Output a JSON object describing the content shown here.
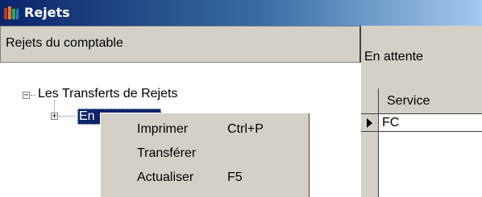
{
  "window": {
    "title": "Rejets",
    "icon": "books-icon"
  },
  "left_panel": {
    "header": "Rejets du comptable",
    "tree": {
      "root_label": "Les Transferts de Rejets",
      "root_expander": "−",
      "child_label": "En",
      "child_expander": "+"
    }
  },
  "right_panel": {
    "header": "En attente",
    "grid": {
      "columns": [
        "Service"
      ],
      "rows": [
        [
          "FC"
        ]
      ]
    }
  },
  "context_menu": {
    "items": [
      {
        "label": "Imprimer",
        "shortcut": "Ctrl+P"
      },
      {
        "label": "Transférer",
        "shortcut": ""
      },
      {
        "label": "Actualiser",
        "shortcut": "F5"
      }
    ]
  },
  "colors": {
    "title_bar": "#0a246a",
    "face": "#d4d0c8",
    "selection": "#0a246a"
  }
}
